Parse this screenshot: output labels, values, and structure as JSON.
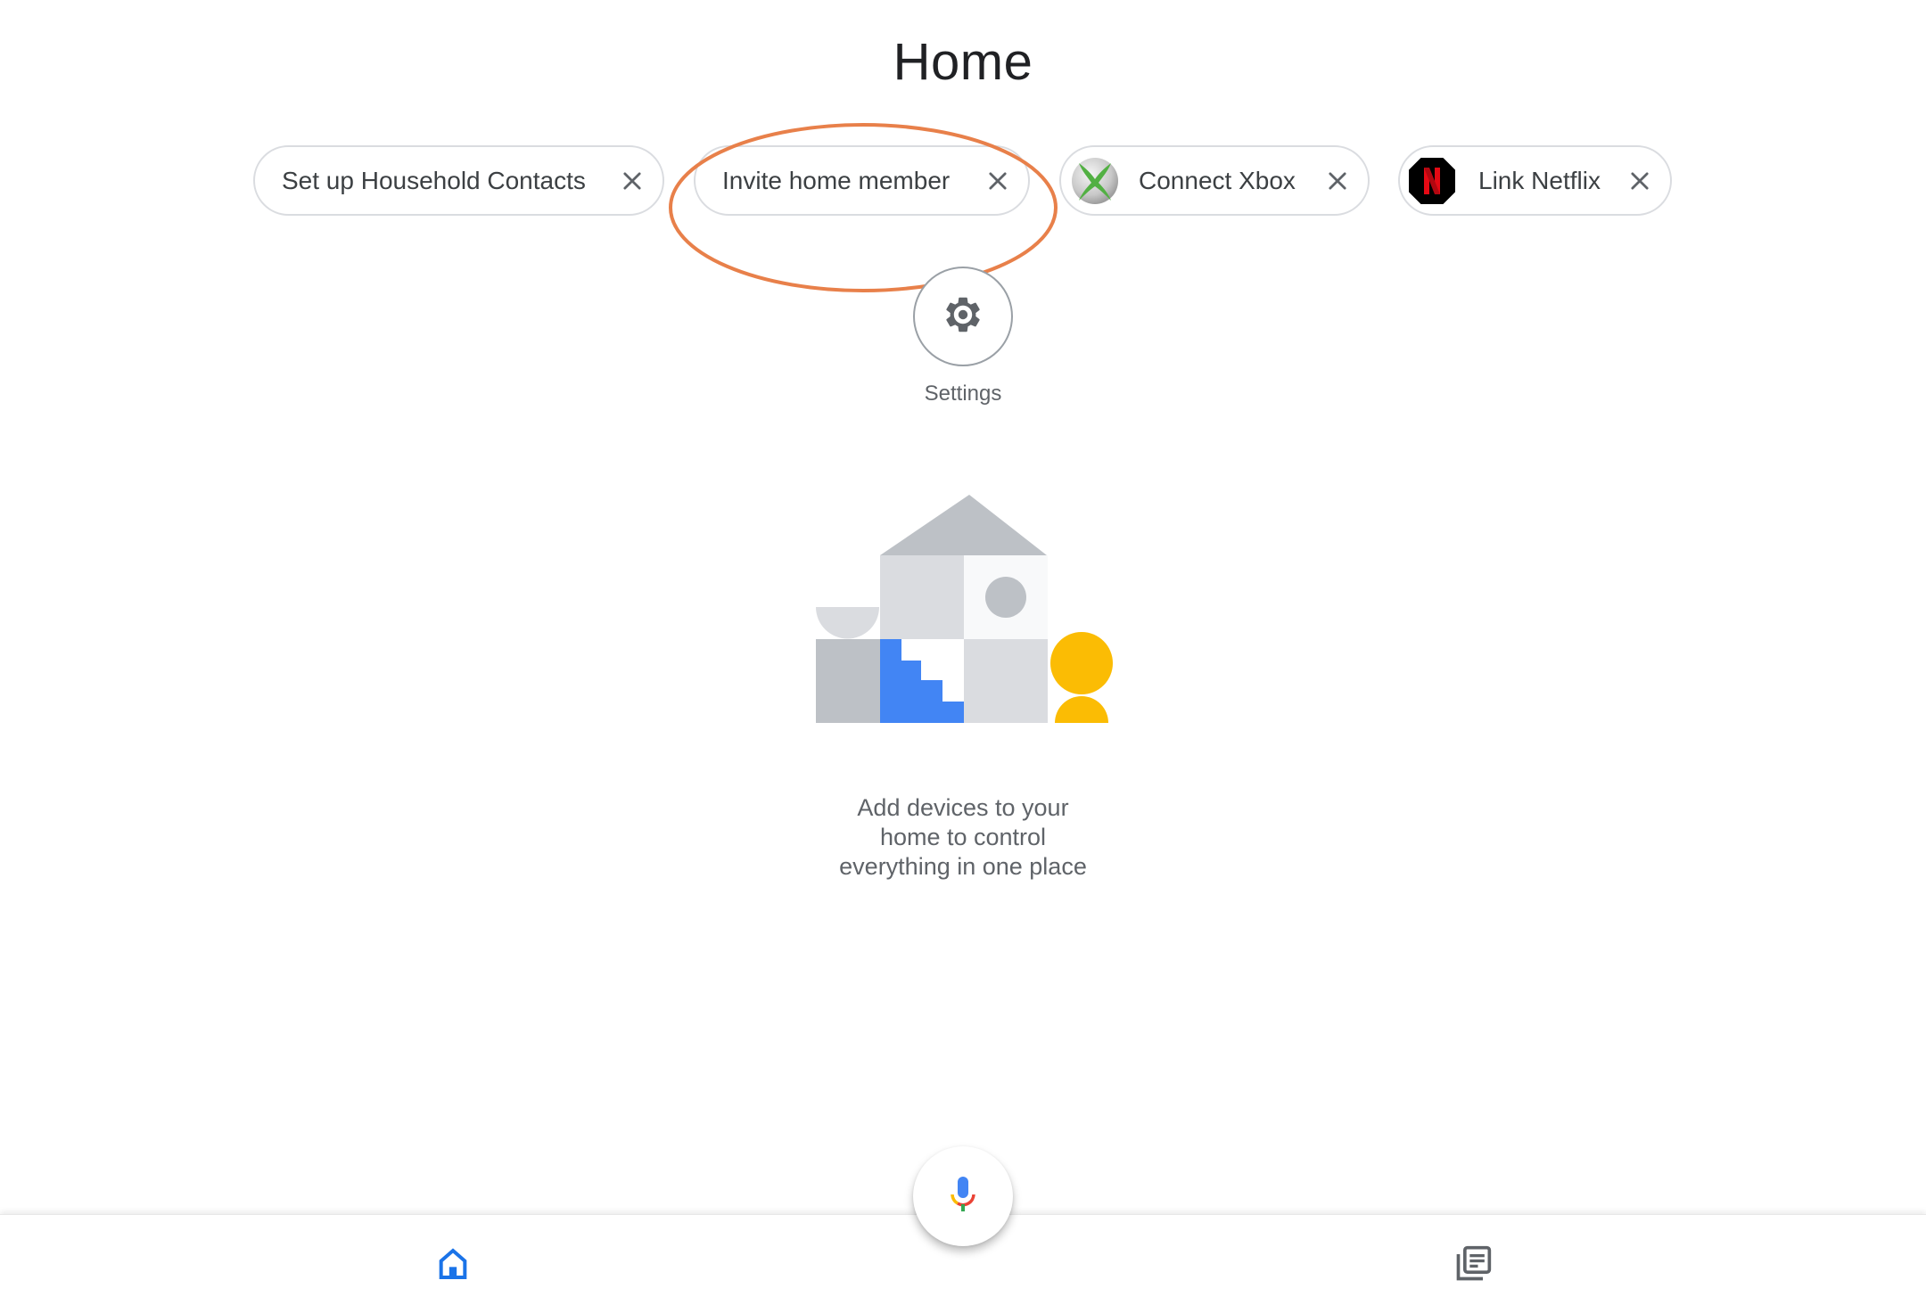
{
  "header": {
    "title": "Home"
  },
  "chips": [
    {
      "label": "Set up Household Contacts",
      "icon": null,
      "close_icon": "close-icon"
    },
    {
      "label": "Invite home member",
      "icon": null,
      "close_icon": "close-icon",
      "highlighted": true
    },
    {
      "label": "Connect Xbox",
      "icon": "xbox-logo-icon",
      "close_icon": "close-icon"
    },
    {
      "label": "Link Netflix",
      "icon": "netflix-logo-icon",
      "close_icon": "close-icon"
    }
  ],
  "settings": {
    "label": "Settings",
    "icon": "gear-icon"
  },
  "empty_state": {
    "line1": "Add devices to your",
    "line2": "home to control",
    "line3": "everything in one place",
    "illustration": "house-illustration"
  },
  "bottom_nav": {
    "items": [
      {
        "name": "home",
        "icon": "home-icon",
        "active": true
      },
      {
        "name": "feed",
        "icon": "feed-icon",
        "active": false
      }
    ],
    "mic": {
      "icon": "microphone-icon"
    }
  },
  "colors": {
    "accent_blue": "#4285f4",
    "nav_active": "#1a73e8",
    "nav_inactive": "#5f6368",
    "highlight_annotation": "#e8804a",
    "google_red": "#ea4335",
    "google_yellow": "#fbbc04",
    "google_green": "#34a853",
    "person_yellow": "#fbbc04"
  }
}
